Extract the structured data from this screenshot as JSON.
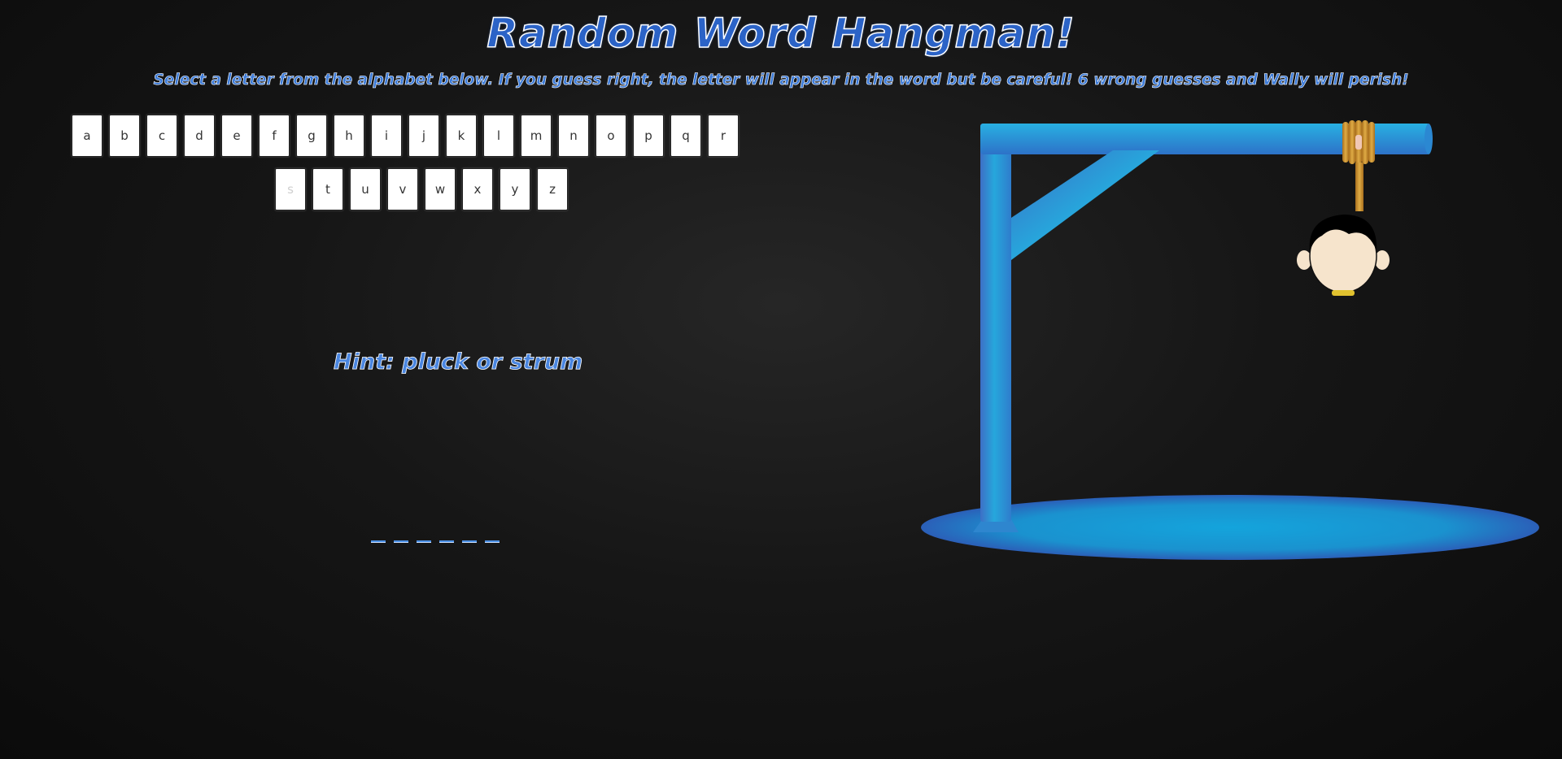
{
  "header": {
    "title": "Random Word Hangman!",
    "instructions": "Select a letter from the alphabet below. If you guess right, the letter will appear in the word but be careful! 6 wrong guesses and Wally will perish!"
  },
  "keyboard": {
    "row1": [
      "a",
      "b",
      "c",
      "d",
      "e",
      "f",
      "g",
      "h",
      "i",
      "j",
      "k",
      "l",
      "m",
      "n",
      "o",
      "p",
      "q",
      "r"
    ],
    "row2": [
      "s",
      "t",
      "u",
      "v",
      "w",
      "x",
      "y",
      "z"
    ],
    "used": [
      "s"
    ]
  },
  "hint": "Hint: pluck or strum",
  "word": {
    "length": 6,
    "revealed": [
      "",
      "",
      "",
      "",
      "",
      ""
    ]
  },
  "game": {
    "wrong_guesses": 1,
    "max_wrong": 6
  },
  "colors": {
    "accent": "#2b63c7",
    "gallows": "#22a0d8",
    "rope": "#c8902a",
    "skin": "#f6e4cc"
  }
}
